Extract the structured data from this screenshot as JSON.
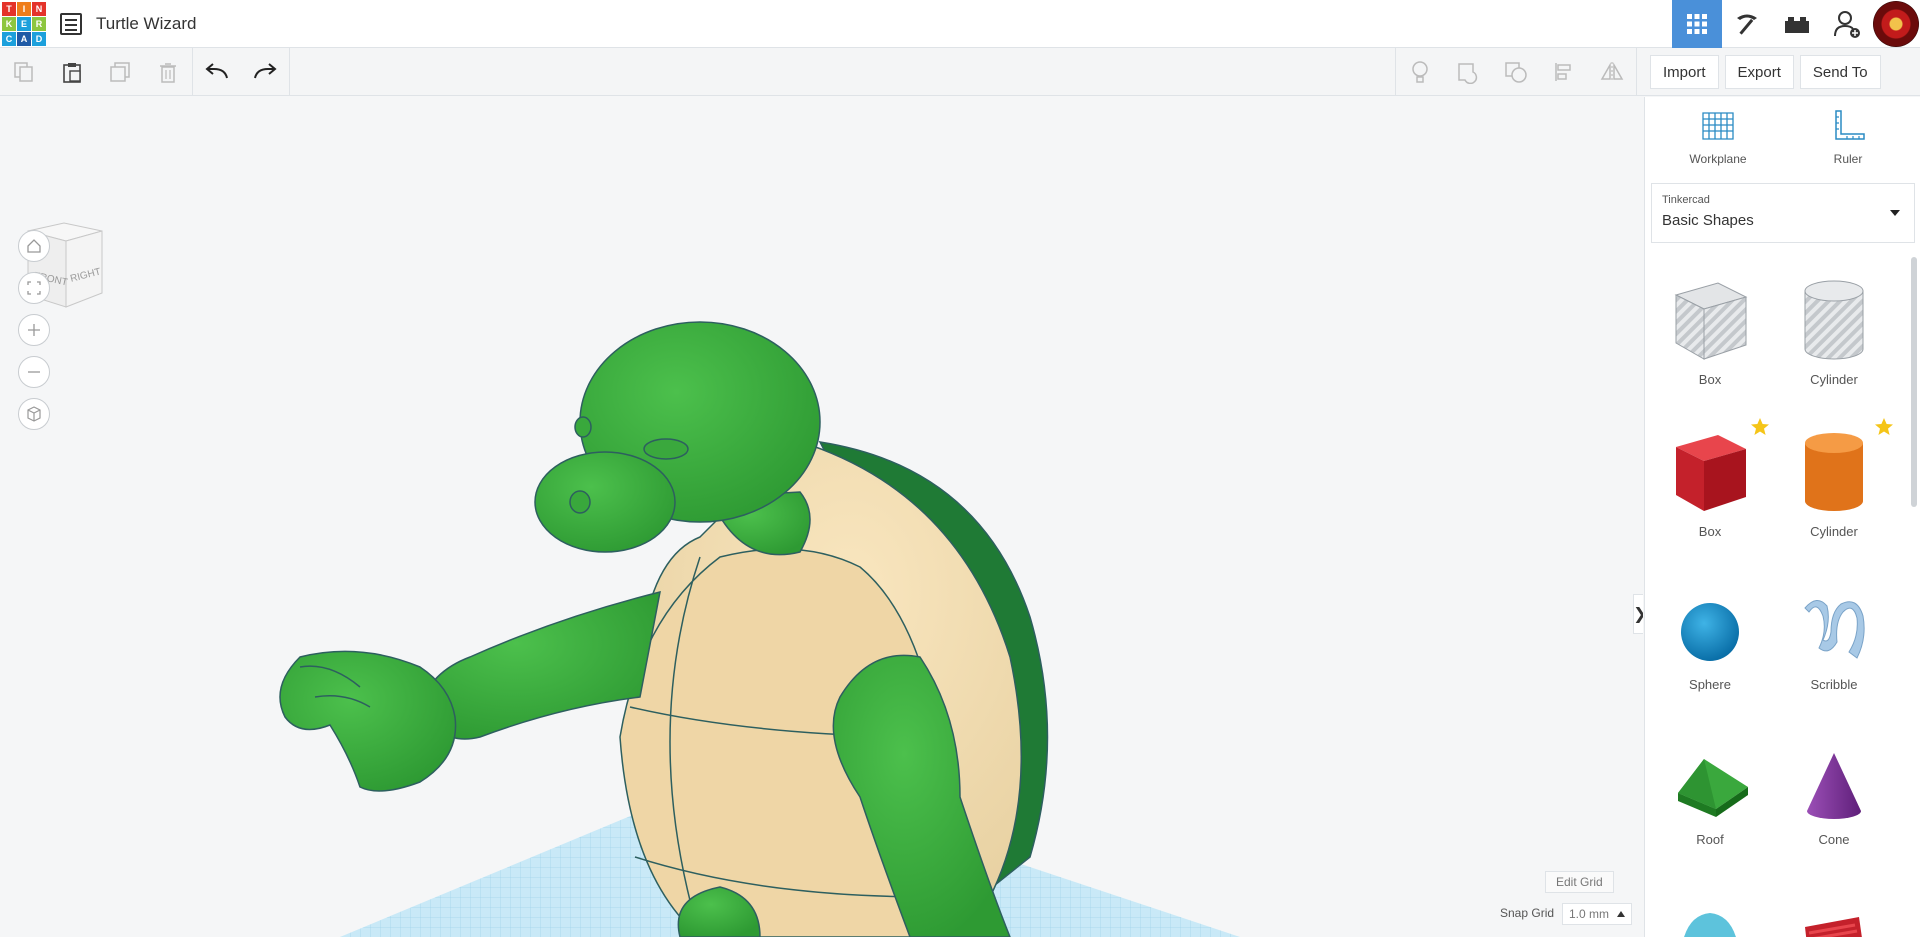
{
  "header": {
    "logo": [
      "T",
      "I",
      "N",
      "K",
      "E",
      "R",
      "C",
      "A",
      "D"
    ],
    "title": "Turtle Wizard"
  },
  "toolbar": {
    "actions": {
      "import_label": "Import",
      "export_label": "Export",
      "send_label": "Send To"
    }
  },
  "viewcube": {
    "front_label": "FRONT",
    "right_label": "RIGHT"
  },
  "canvas": {
    "edit_grid_label": "Edit Grid",
    "snap_grid_label": "Snap Grid",
    "snap_grid_value": "1.0 mm",
    "collapse_glyph": "❯"
  },
  "panel": {
    "workplane_label": "Workplane",
    "ruler_label": "Ruler",
    "library": {
      "source": "Tinkercad",
      "category": "Basic Shapes"
    },
    "shapes": [
      {
        "label": "Box"
      },
      {
        "label": "Cylinder"
      },
      {
        "label": "Box"
      },
      {
        "label": "Cylinder"
      },
      {
        "label": "Sphere"
      },
      {
        "label": "Scribble"
      },
      {
        "label": "Roof"
      },
      {
        "label": "Cone"
      }
    ]
  },
  "colors": {
    "accent": "#4a90d9",
    "turtle_green": "#3fae3f",
    "shell_cream": "#f0dbb0",
    "shell_dark": "#1f7a35",
    "grid_blue": "#b8e0f2"
  }
}
